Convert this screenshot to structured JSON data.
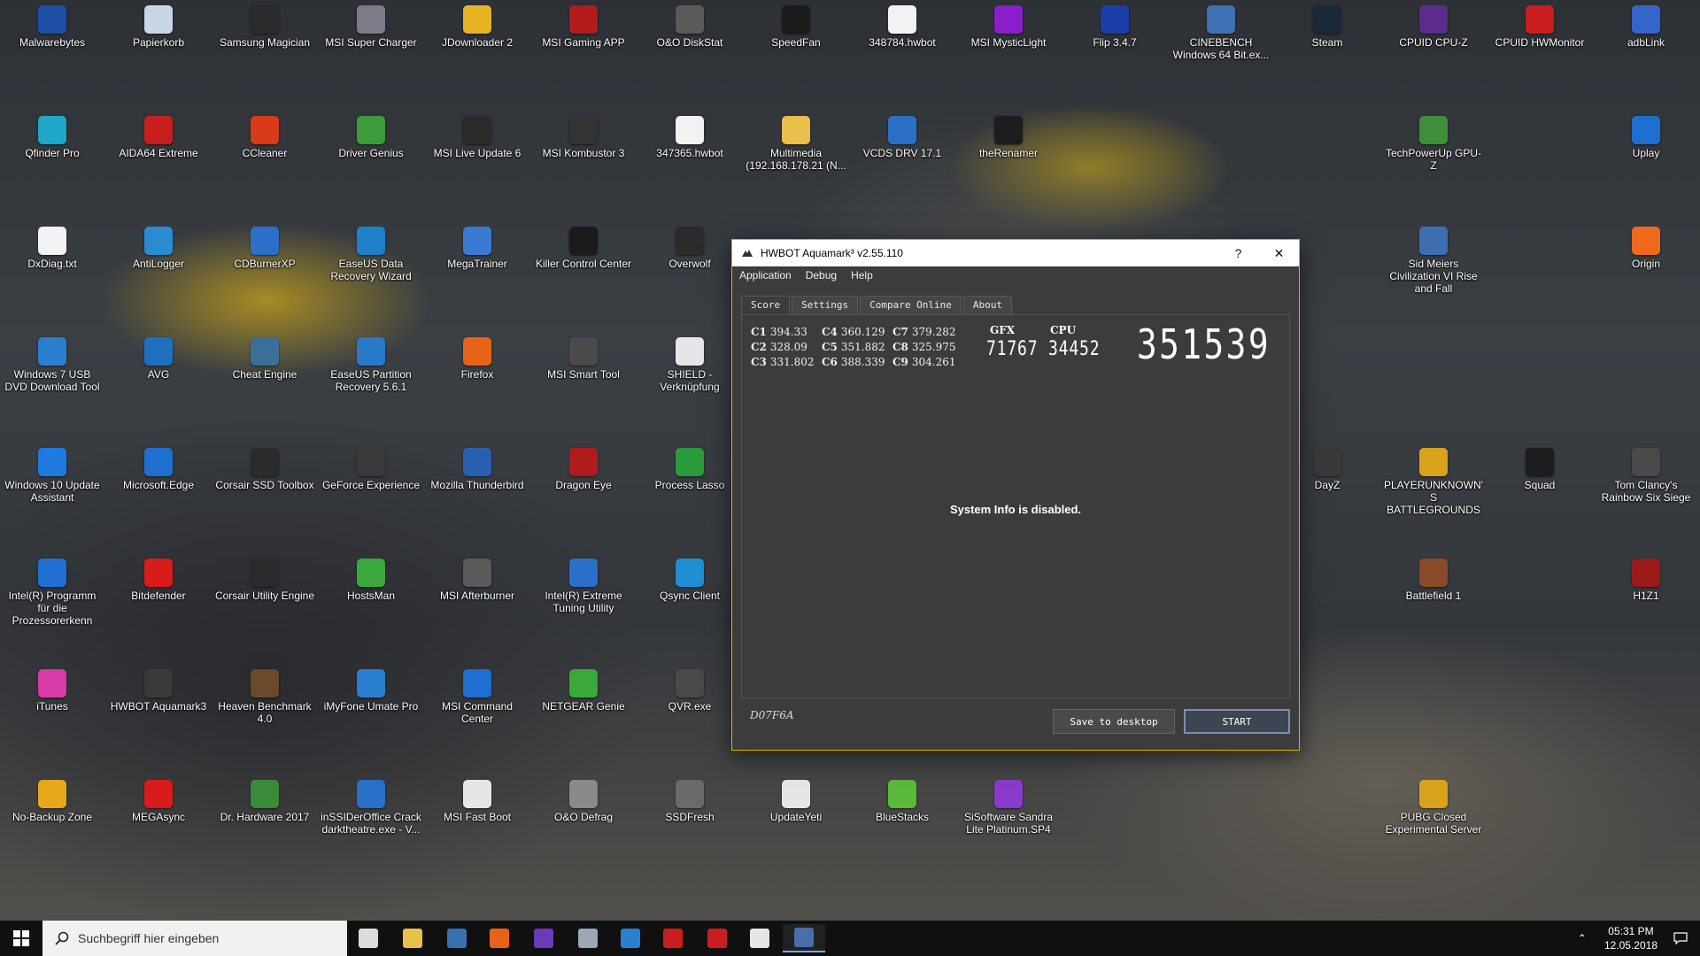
{
  "desktop_icons": [
    {
      "label": "Malwarebytes",
      "color": "#1e4fa8"
    },
    {
      "label": "Papierkorb",
      "color": "#c9d6e3"
    },
    {
      "label": "Samsung Magician",
      "color": "#2a2a2a"
    },
    {
      "label": "MSI Super Charger",
      "color": "#7b7b8a"
    },
    {
      "label": "JDownloader 2",
      "color": "#e6b322"
    },
    {
      "label": "MSI Gaming APP",
      "color": "#b21b1b"
    },
    {
      "label": "O&O DiskStat",
      "color": "#5a5a5a"
    },
    {
      "label": "SpeedFan",
      "color": "#1c1c1c"
    },
    {
      "label": "348784.hwbot",
      "color": "#f2f2f2"
    },
    {
      "label": "MSI MysticLight",
      "color": "#8a1ec9"
    },
    {
      "label": "Flip 3.4.7",
      "color": "#1c3ca8"
    },
    {
      "label": "CINEBENCH Windows 64 Bit.ex...",
      "color": "#3f6fb5"
    },
    {
      "label": "Steam",
      "color": "#1b2838"
    },
    {
      "label": "CPUID CPU-Z",
      "color": "#5b2c8c"
    },
    {
      "label": "CPUID HWMonitor",
      "color": "#c81e1e"
    },
    {
      "label": "adbLink",
      "color": "#3565c8"
    },
    {
      "label": "Qfinder Pro",
      "color": "#1fa7c9"
    },
    {
      "label": "AIDA64 Extreme",
      "color": "#c81e1e"
    },
    {
      "label": "CCleaner",
      "color": "#d83a1a"
    },
    {
      "label": "Driver Genius",
      "color": "#3c9b3a"
    },
    {
      "label": "MSI Live Update 6",
      "color": "#2b2b2b"
    },
    {
      "label": "MSI Kombustor 3",
      "color": "#333333"
    },
    {
      "label": "347365.hwbot",
      "color": "#f2f2f2"
    },
    {
      "label": "Multimedia (192.168.178.21 (N...",
      "color": "#e8c04a"
    },
    {
      "label": "VCDS DRV 17.1",
      "color": "#2a70c8"
    },
    {
      "label": "theRenamer",
      "color": "#1d1d1d"
    },
    {
      "label": "TechPowerUp GPU-Z",
      "color": "#3e8f3a"
    },
    {
      "label": "Uplay",
      "color": "#1f6fd1"
    },
    {
      "label": "DxDiag.txt",
      "color": "#f2f2f2"
    },
    {
      "label": "AntiLogger",
      "color": "#2a8bd1"
    },
    {
      "label": "CDBurnerXP",
      "color": "#2b6fc9"
    },
    {
      "label": "EaseUS Data Recovery Wizard",
      "color": "#1f7fc9"
    },
    {
      "label": "MegaTrainer",
      "color": "#3a7ad1"
    },
    {
      "label": "Killer Control Center",
      "color": "#1b1b1b"
    },
    {
      "label": "Overwolf",
      "color": "#2b2b2b"
    },
    {
      "label": "Sid Meiers Civilization VI Rise and Fall",
      "color": "#3d6fb0"
    },
    {
      "label": "Origin",
      "color": "#f06a1e"
    },
    {
      "label": "Windows 7 USB DVD Download Tool",
      "color": "#2a7fd1"
    },
    {
      "label": "AVG",
      "color": "#1f6fbf"
    },
    {
      "label": "Cheat Engine",
      "color": "#3a6f9a"
    },
    {
      "label": "EaseUS Partition Recovery 5.6.1",
      "color": "#2a78c8"
    },
    {
      "label": "Firefox",
      "color": "#e8631a"
    },
    {
      "label": "MSI Smart Tool",
      "color": "#4a4a4a"
    },
    {
      "label": "SHIELD - Verknüpfung",
      "color": "#e6e6e6"
    },
    {
      "label": "Windows 10 Update Assistant",
      "color": "#1f7ae0"
    },
    {
      "label": "Microsoft.Edge",
      "color": "#1f6fd1"
    },
    {
      "label": "Corsair SSD Toolbox",
      "color": "#2b2b2b"
    },
    {
      "label": "GeForce Experience",
      "color": "#3a3a3a"
    },
    {
      "label": "Mozilla Thunderbird",
      "color": "#2a5fb0"
    },
    {
      "label": "Dragon Eye",
      "color": "#b21b1b"
    },
    {
      "label": "Process Lasso",
      "color": "#2a9b3a"
    },
    {
      "label": "DayZ",
      "color": "#3a3a3a"
    },
    {
      "label": "PLAYERUNKNOWN'S BATTLEGROUNDS",
      "color": "#d8a21a"
    },
    {
      "label": "Squad",
      "color": "#1d1d1d"
    },
    {
      "label": "Tom Clancy's Rainbow Six Siege",
      "color": "#4a4a4a"
    },
    {
      "label": "Intel(R) Programm für die Prozessorerkenn",
      "color": "#1f6fd1"
    },
    {
      "label": "Bitdefender",
      "color": "#d81b1b"
    },
    {
      "label": "Corsair Utility Engine",
      "color": "#2a2a2a"
    },
    {
      "label": "HostsMan",
      "color": "#3aa83a"
    },
    {
      "label": "MSI Afterburner",
      "color": "#5a5a5a"
    },
    {
      "label": "Intel(R) Extreme Tuning Utility",
      "color": "#2a70c8"
    },
    {
      "label": "Qsync Client",
      "color": "#1f8fd1"
    },
    {
      "label": "Battlefield 1",
      "color": "#8a4a2a"
    },
    {
      "label": "H1Z1",
      "color": "#9b1b1b"
    },
    {
      "label": "iTunes",
      "color": "#d83aa8"
    },
    {
      "label": "HWBOT Aquamark3",
      "color": "#3a3a3a"
    },
    {
      "label": "Heaven Benchmark 4.0",
      "color": "#6a4a2a"
    },
    {
      "label": "iMyFone Umate Pro",
      "color": "#2a7fd1"
    },
    {
      "label": "MSI Command Center",
      "color": "#1f6fd1"
    },
    {
      "label": "NETGEAR Genie",
      "color": "#3aa83a"
    },
    {
      "label": "QVR.exe",
      "color": "#4a4a4a"
    },
    {
      "label": "No-Backup Zone",
      "color": "#e6a81a"
    },
    {
      "label": "MEGAsync",
      "color": "#d81b1b"
    },
    {
      "label": "Dr. Hardware 2017",
      "color": "#3a8a3a"
    },
    {
      "label": "inSSIDerOffice Crack darktheatre.exe - V...",
      "color": "#2a70c8"
    },
    {
      "label": "MSI Fast Boot",
      "color": "#e6e6e6"
    },
    {
      "label": "O&O Defrag",
      "color": "#8a8a8a"
    },
    {
      "label": "SSDFresh",
      "color": "#6a6a6a"
    },
    {
      "label": "UpdateYeti",
      "color": "#e6e6e6"
    },
    {
      "label": "BlueStacks",
      "color": "#5ab83a"
    },
    {
      "label": "SiSoftware Sandra Lite Platinum.SP4",
      "color": "#8a3ac8"
    },
    {
      "label": "PUBG Closed Experimental Server",
      "color": "#d8a21a"
    }
  ],
  "window": {
    "title": "HWBOT Aquamark³ v2.55.110",
    "help_label": "?",
    "close_label": "✕",
    "menu": [
      "Application",
      "Debug",
      "Help"
    ],
    "tabs": [
      "Score",
      "Settings",
      "Compare Online",
      "About"
    ],
    "active_tab": "Score",
    "scores": [
      [
        {
          "id": "C1",
          "value": "394.33"
        },
        {
          "id": "C4",
          "value": "360.129"
        },
        {
          "id": "C7",
          "value": "379.282"
        }
      ],
      [
        {
          "id": "C2",
          "value": "328.09"
        },
        {
          "id": "C5",
          "value": "351.882"
        },
        {
          "id": "C8",
          "value": "325.975"
        }
      ],
      [
        {
          "id": "C3",
          "value": "331.802"
        },
        {
          "id": "C6",
          "value": "388.339"
        },
        {
          "id": "C9",
          "value": "304.261"
        }
      ]
    ],
    "gfx_label": "GFX",
    "gfx_value": "71767",
    "cpu_label": "CPU",
    "cpu_value": "34452",
    "total_score": "351539",
    "sysinfo": "System Info is disabled.",
    "code": "D07F6A",
    "save_label": "Save to desktop",
    "start_label": "START"
  },
  "taskbar": {
    "search_placeholder": "Suchbegriff hier eingeben",
    "pinned": [
      {
        "name": "task-view",
        "color": "#dcdcdc"
      },
      {
        "name": "file-explorer",
        "color": "#e8c04a"
      },
      {
        "name": "edge-legacy",
        "color": "#3a6fb0"
      },
      {
        "name": "firefox",
        "color": "#e8631a"
      },
      {
        "name": "cpu-z",
        "color": "#6a3ab8"
      },
      {
        "name": "network-tool",
        "color": "#9aa8b8"
      },
      {
        "name": "notepad-tool",
        "color": "#2a7fd1"
      },
      {
        "name": "aida64",
        "color": "#c81e1e"
      },
      {
        "name": "hwmonitor",
        "color": "#c81e1e"
      },
      {
        "name": "panda-app",
        "color": "#e6e6e6"
      },
      {
        "name": "aquamark",
        "color": "#4a6fa8"
      }
    ],
    "time": "05:31 PM",
    "date": "12.05.2018"
  }
}
